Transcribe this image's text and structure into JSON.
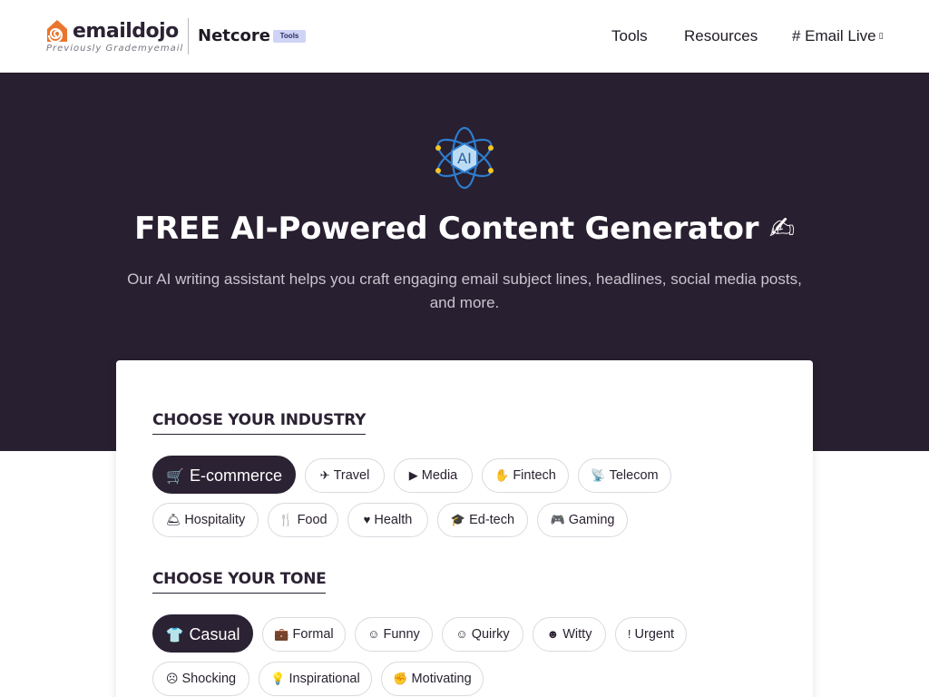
{
  "brand": {
    "logo_text": "emaildojo",
    "logo_sub": "Previously Grademyemail",
    "partner": "Netcore",
    "badge": "Tools",
    "logo_icon": "spiral-house-icon",
    "accent_color": "#e8762e"
  },
  "nav": {
    "tools": "Tools",
    "resources": "Resources",
    "email_live": "# Email Live",
    "ext_icon": "external-link-icon"
  },
  "hero": {
    "icon": "ai-atom-icon",
    "icon_label": "AI",
    "title": "FREE AI-Powered Content Generator ✍",
    "description": "Our AI writing assistant helps you craft engaging email subject lines, headlines, social media posts, and more.",
    "background_color": "#281f30"
  },
  "industry": {
    "heading": "CHOOSE YOUR INDUSTRY",
    "selected": "E-commerce",
    "options": [
      {
        "label": "E-commerce",
        "icon": "cart-icon",
        "glyph": "🛒"
      },
      {
        "label": "Travel",
        "icon": "plane-icon",
        "glyph": "✈"
      },
      {
        "label": "Media",
        "icon": "play-circle-icon",
        "glyph": "▶"
      },
      {
        "label": "Fintech",
        "icon": "hand-coin-icon",
        "glyph": "✋"
      },
      {
        "label": "Telecom",
        "icon": "satellite-dish-icon",
        "glyph": "📡"
      },
      {
        "label": "Hospitality",
        "icon": "concierge-bell-icon",
        "glyph": "🛎"
      },
      {
        "label": "Food",
        "icon": "utensils-icon",
        "glyph": "🍴"
      },
      {
        "label": "Health",
        "icon": "heartbeat-icon",
        "glyph": "♥"
      },
      {
        "label": "Ed-tech",
        "icon": "graduation-cap-icon",
        "glyph": "🎓"
      },
      {
        "label": "Gaming",
        "icon": "gamepad-icon",
        "glyph": "🎮"
      }
    ]
  },
  "tone": {
    "heading": "CHOOSE YOUR TONE",
    "selected": "Casual",
    "options": [
      {
        "label": "Casual",
        "icon": "tshirt-icon",
        "glyph": "👕"
      },
      {
        "label": "Formal",
        "icon": "briefcase-icon",
        "glyph": "💼"
      },
      {
        "label": "Funny",
        "icon": "laugh-icon",
        "glyph": "☺"
      },
      {
        "label": "Quirky",
        "icon": "grin-icon",
        "glyph": "☺"
      },
      {
        "label": "Witty",
        "icon": "smile-wink-icon",
        "glyph": "☻"
      },
      {
        "label": "Urgent",
        "icon": "exclamation-icon",
        "glyph": "!"
      },
      {
        "label": "Shocking",
        "icon": "surprise-icon",
        "glyph": "☹"
      },
      {
        "label": "Inspirational",
        "icon": "lightbulb-icon",
        "glyph": "💡"
      },
      {
        "label": "Motivating",
        "icon": "fist-icon",
        "glyph": "✊"
      }
    ]
  }
}
